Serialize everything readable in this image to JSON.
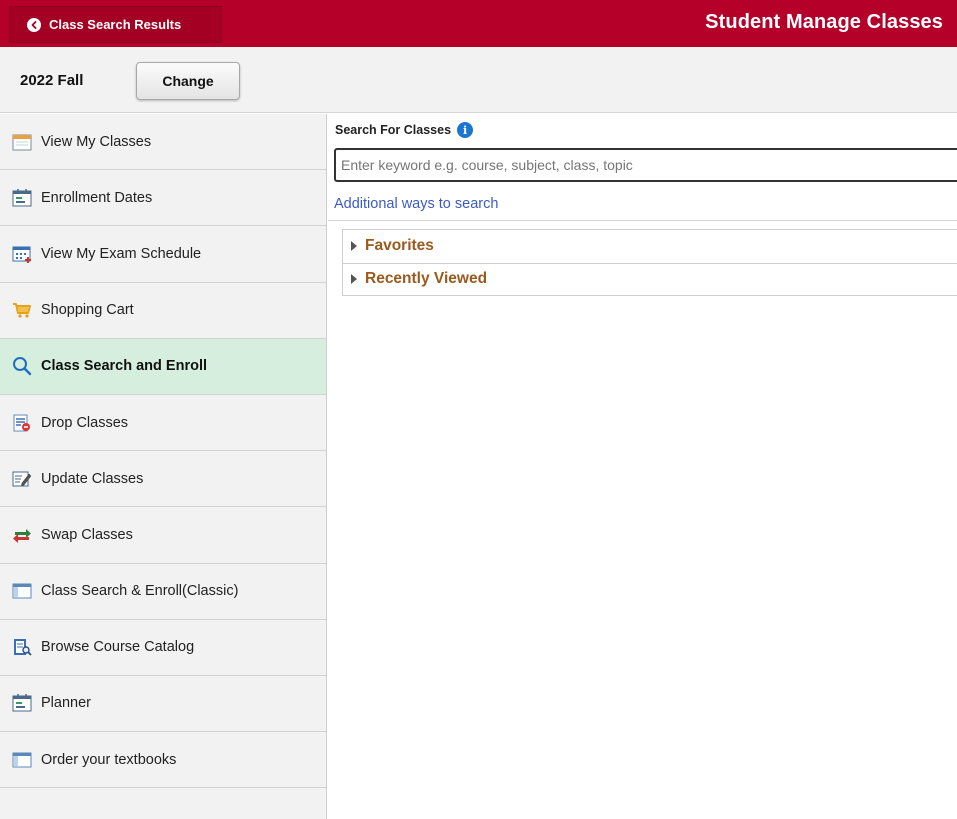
{
  "header": {
    "back_label": "Class Search Results",
    "title": "Student Manage Classes",
    "brand_color": "#b5002a"
  },
  "term": {
    "label": "2022 Fall",
    "change_label": "Change"
  },
  "sidebar": {
    "items": [
      {
        "label": "View My Classes",
        "icon": "calendar-icon"
      },
      {
        "label": "Enrollment Dates",
        "icon": "calendar-dates-icon"
      },
      {
        "label": "View My Exam Schedule",
        "icon": "calendar-add-icon"
      },
      {
        "label": "Shopping Cart",
        "icon": "shopping-cart-icon"
      },
      {
        "label": "Class Search and Enroll",
        "icon": "search-icon",
        "active": true
      },
      {
        "label": "Drop Classes",
        "icon": "drop-list-icon"
      },
      {
        "label": "Update Classes",
        "icon": "edit-document-icon"
      },
      {
        "label": "Swap Classes",
        "icon": "swap-arrows-icon"
      },
      {
        "label": "Class Search & Enroll(Classic)",
        "icon": "window-icon"
      },
      {
        "label": "Browse Course Catalog",
        "icon": "catalog-search-icon"
      },
      {
        "label": "Planner",
        "icon": "planner-calendar-icon"
      },
      {
        "label": "Order your textbooks",
        "icon": "window-icon"
      }
    ],
    "active_color": "#d6eedd"
  },
  "search": {
    "title": "Search For Classes",
    "placeholder": "Enter keyword e.g. course, subject, class, topic",
    "value": "",
    "additional_link": "Additional ways to search"
  },
  "groups": [
    {
      "label": "Favorites"
    },
    {
      "label": "Recently Viewed"
    }
  ]
}
